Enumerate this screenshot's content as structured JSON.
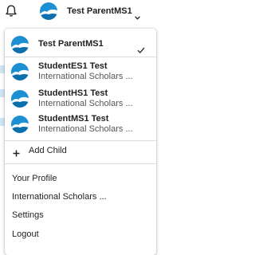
{
  "topbar": {
    "account_name": "Test ParentMS1"
  },
  "menu": {
    "accounts": [
      {
        "name": "Test ParentMS1",
        "org": "",
        "selected": true
      },
      {
        "name": "StudentES1 Test",
        "org": "International Scholars ...",
        "selected": false
      },
      {
        "name": "StudentHS1 Test",
        "org": "International Scholars ...",
        "selected": false
      },
      {
        "name": "StudentMS1 Test",
        "org": "International Scholars ...",
        "selected": false
      }
    ],
    "add_child_label": "Add Child",
    "links": {
      "profile": "Your Profile",
      "org": "International Scholars ...",
      "settings": "Settings",
      "logout": "Logout"
    }
  },
  "colors": {
    "avatar_blue": "#1d8fd3",
    "text": "#1f1f1f",
    "subtext": "#555555",
    "divider": "#dcdcdc"
  },
  "icons": {
    "bell": "bell-icon",
    "chevron": "chevron-down-icon",
    "check": "check-icon",
    "plus": "plus-icon"
  }
}
